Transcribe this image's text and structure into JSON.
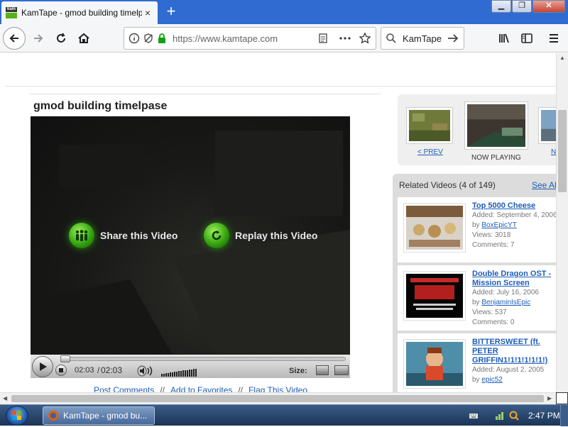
{
  "browser": {
    "tab_title": "KamTape - gmod building timelpase",
    "tab_close": "×",
    "new_tab": "+",
    "favicon_text": "kam",
    "window_buttons": {
      "minimize": "▁",
      "restore": "❐",
      "close": "✕"
    },
    "url": "https://www.kamtape.com",
    "search_engine": "KamTape"
  },
  "video": {
    "title": "gmod building timelpase",
    "overlay": {
      "share_label": "Share this Video",
      "replay_label": "Replay this Video"
    },
    "controls": {
      "current_time": "02:03",
      "separator": "/",
      "total_time": "02:03",
      "size_label": "Size:",
      "progress": 0.0,
      "volume": 1.0
    }
  },
  "actions": {
    "post_comments": "Post Comments",
    "add_favorites": "Add to Favorites",
    "flag_video": "Flag This Video",
    "separator": "//"
  },
  "filmstrip": {
    "prev_label": "< PREV",
    "now_playing_label": "NOW PLAYING",
    "next_label": "N"
  },
  "related": {
    "heading": "Related Videos (4 of 149)",
    "see_all": "See All",
    "items": [
      {
        "title": "Top 5000 Cheese",
        "added": "Added: September 4, 2006",
        "by_prefix": "by",
        "author": "BoxEpicYT",
        "views": "Views: 3018",
        "comments": "Comments: 7"
      },
      {
        "title": "Double Dragon OST - Mission Screen",
        "added": "Added: July 16, 2006",
        "by_prefix": "by",
        "author": "BenjaminIsEpic",
        "views": "Views: 537",
        "comments": "Comments: 0"
      },
      {
        "title": "BITTERSWEET (ft. PETER GRIFFIN1!1!1!1!1!1!)",
        "added": "Added: August 2, 2005",
        "by_prefix": "by",
        "author": "epic52"
      }
    ]
  },
  "taskbar": {
    "task_label": "KamTape - gmod bu...",
    "clock": "2:47 PM"
  },
  "colors": {
    "link": "#1d5db8",
    "accent_green": "#33a40f",
    "tabstrip": "#2f6bd0"
  }
}
